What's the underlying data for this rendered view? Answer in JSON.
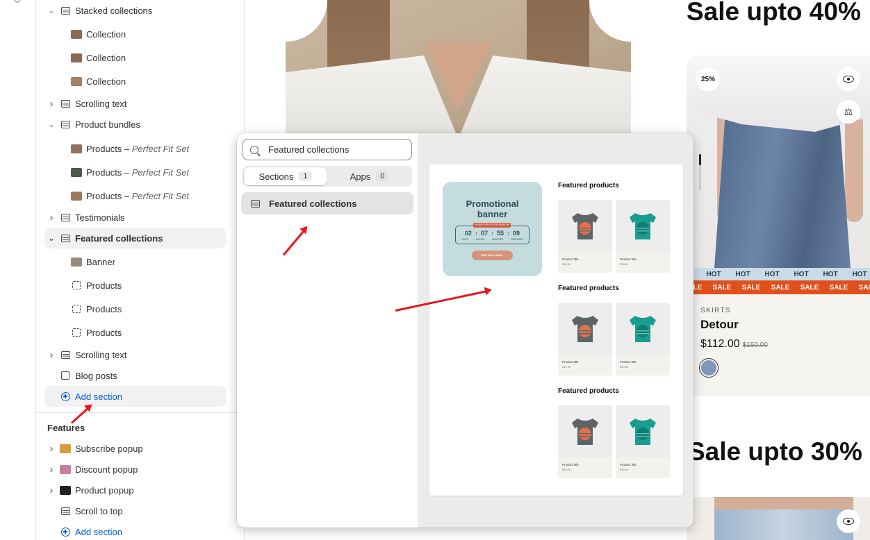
{
  "sidebar": {
    "items": [
      {
        "label": "Stacked collections",
        "sub": "",
        "chevron": "v",
        "icon": "section-lines-icon"
      },
      {
        "label": "Collection",
        "sub": "",
        "chevron": "",
        "icon": "image-thumb-icon"
      },
      {
        "label": "Collection",
        "sub": "",
        "chevron": "",
        "icon": "image-thumb-icon"
      },
      {
        "label": "Collection",
        "sub": "",
        "chevron": "",
        "icon": "image-thumb-icon"
      },
      {
        "label": "Scrolling text",
        "sub": "",
        "chevron": ">",
        "icon": "text-block-icon"
      },
      {
        "label": "Product bundles",
        "sub": "",
        "chevron": "v",
        "icon": "section-lines-icon"
      },
      {
        "label": "Products – ",
        "sub": "Perfect Fit Set",
        "chevron": "",
        "icon": "image-thumb-icon"
      },
      {
        "label": "Products – ",
        "sub": "Perfect Fit Set",
        "chevron": "",
        "icon": "image-thumb-icon"
      },
      {
        "label": "Products – ",
        "sub": "Perfect Fit Set",
        "chevron": "",
        "icon": "image-thumb-icon"
      },
      {
        "label": "Testimonials",
        "sub": "",
        "chevron": ">",
        "icon": "list-icon"
      },
      {
        "label": "Featured collections",
        "sub": "",
        "chevron": "v",
        "icon": "section-lines-icon"
      },
      {
        "label": "Banner",
        "sub": "",
        "chevron": "",
        "icon": "image-thumb-icon"
      },
      {
        "label": "Products",
        "sub": "",
        "chevron": "",
        "icon": "dashed-box-icon"
      },
      {
        "label": "Products",
        "sub": "",
        "chevron": "",
        "icon": "dashed-box-icon"
      },
      {
        "label": "Products",
        "sub": "",
        "chevron": "",
        "icon": "dashed-box-icon"
      },
      {
        "label": "Scrolling text",
        "sub": "",
        "chevron": ">",
        "icon": "text-block-icon"
      },
      {
        "label": "Blog posts",
        "sub": "",
        "chevron": "",
        "icon": "edit-icon"
      },
      {
        "label": "Add section",
        "sub": "",
        "chevron": "",
        "icon": "plus-circle-icon"
      }
    ],
    "features_title": "Features",
    "features": [
      {
        "label": "Subscribe popup",
        "chevron": ">"
      },
      {
        "label": "Discount popup",
        "chevron": ">"
      },
      {
        "label": "Product popup",
        "chevron": ">"
      },
      {
        "label": "Scroll to top",
        "chevron": ""
      },
      {
        "label": "Add section",
        "chevron": ""
      }
    ]
  },
  "popover": {
    "search_value": "Featured collections",
    "tabs": [
      {
        "label": "Sections",
        "count": "1"
      },
      {
        "label": "Apps",
        "count": "0"
      }
    ],
    "result": "Featured collections",
    "preview": {
      "promo_title_1": "Promotional",
      "promo_title_2": "banner",
      "promo_tag": "HURRY UP! OFFER ENDS IN",
      "timer": [
        "02",
        "07",
        "55",
        "09"
      ],
      "timer_labels": [
        "DAYS",
        "HOURS",
        "MINUTES",
        "SECONDS"
      ],
      "button_label": "BUTTON LABEL",
      "fp_heading": "Featured products",
      "product_title": "Product title",
      "product_price": "$19.99"
    }
  },
  "storefront": {
    "sale_top": "Sale upto 40%",
    "sale_bottom": "Sale upto 30%",
    "badge": "25%",
    "hot": "HOT",
    "sale": "SALE",
    "vendor": "SKIRTS",
    "product_name": "Detour",
    "price": "$112.00",
    "compare_price": "$150.00"
  },
  "colors": {
    "accent_blue": "#005bd3",
    "annotation_red": "#e8161b",
    "sale_orange": "#e0501d"
  }
}
